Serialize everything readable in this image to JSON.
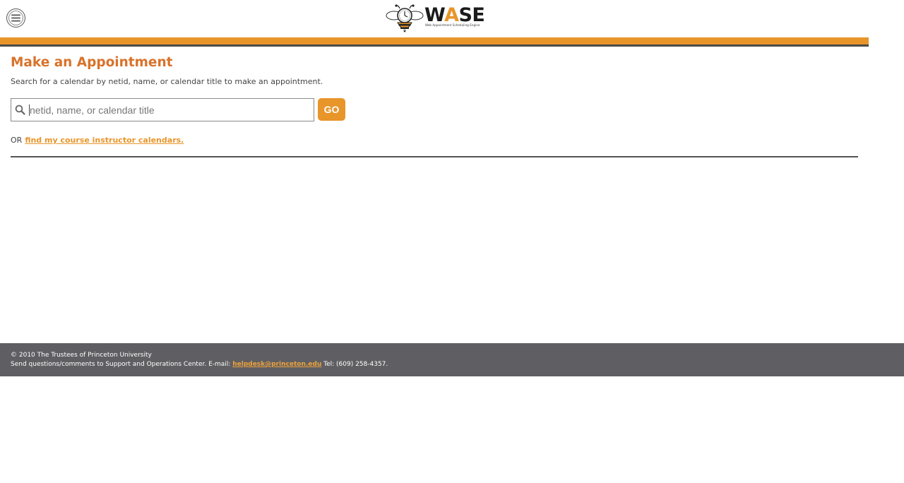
{
  "header": {
    "logo_text_w": "W",
    "logo_text_a": "A",
    "logo_text_se": "SE",
    "logo_subtitle": "Web Appointment Scheduling Engine"
  },
  "colors": {
    "accent": "#e8952a",
    "title": "#d9722a",
    "footer_bg": "#5f5f63"
  },
  "main": {
    "title": "Make an Appointment",
    "description": "Search for a calendar by netid, name, or calendar title to make an appointment.",
    "search_placeholder": "netid, name, or calendar title",
    "search_value": "",
    "go_label": "GO",
    "or_label": "OR",
    "course_link": "find my course instructor calendars."
  },
  "footer": {
    "copyright": "© 2010 The Trustees of Princeton University",
    "contact_prefix": "Send questions/comments to Support and Operations Center. E-mail:",
    "email": "helpdesk@princeton.edu",
    "tel": "Tel: (609) 258-4357."
  }
}
